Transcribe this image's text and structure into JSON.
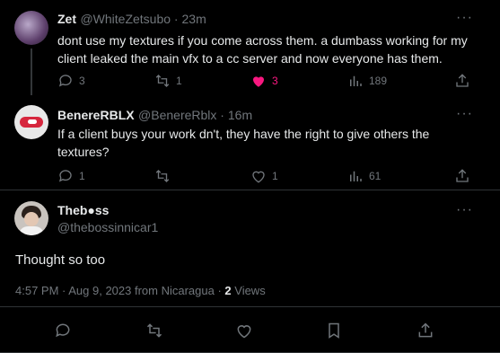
{
  "tweets": [
    {
      "name": "Zet",
      "handle": "@WhiteZetsubo",
      "time": "23m",
      "text_line1": "dont use my textures if you come across them. a dumbass working for my",
      "text_line2": "client leaked the main vfx to a cc server and now everyone has them.",
      "replies": "3",
      "retweets": "1",
      "likes": "3",
      "views": "189",
      "liked": true
    },
    {
      "name": "BenereRBLX",
      "handle": "@BenereRblx",
      "time": "16m",
      "text_line1": "If a client buys your work dn't, they have the right to give others the",
      "text_line2": "textures?",
      "replies": "1",
      "retweets": "",
      "likes": "1",
      "views": "61",
      "liked": false
    }
  ],
  "main_tweet": {
    "name": "Theb●ss",
    "handle": "@thebossinnicar1",
    "text": "Thought so too",
    "timestamp": "4:57 PM · Aug 9, 2023 from Nicaragua · ",
    "views_count": "2",
    "views_label": " Views"
  },
  "separator": " · ",
  "more_label": "···",
  "colors": {
    "like_active": "#f91880",
    "muted": "#71767b",
    "text": "#e7e9ea"
  }
}
